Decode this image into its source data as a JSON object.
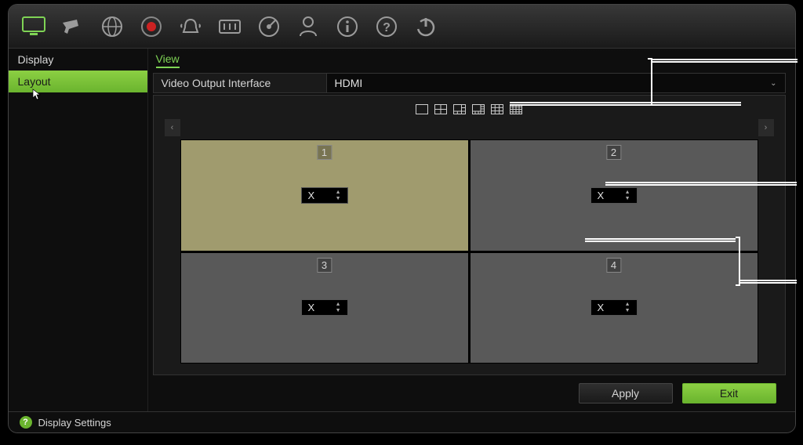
{
  "toolbar_icons": [
    {
      "name": "monitor-icon",
      "active": true
    },
    {
      "name": "camera-icon"
    },
    {
      "name": "globe-icon"
    },
    {
      "name": "record-icon"
    },
    {
      "name": "alarm-icon"
    },
    {
      "name": "settings-slider-icon"
    },
    {
      "name": "hdd-icon"
    },
    {
      "name": "user-icon"
    },
    {
      "name": "info-icon"
    },
    {
      "name": "help-icon"
    },
    {
      "name": "power-icon"
    }
  ],
  "sidebar": {
    "items": [
      {
        "label": "Display",
        "active": false
      },
      {
        "label": "Layout",
        "active": true
      }
    ]
  },
  "tabs": [
    {
      "label": "View",
      "active": true
    }
  ],
  "video_output": {
    "label": "Video Output Interface",
    "value": "HDMI"
  },
  "layout_icons": [
    {
      "name": "layout-1x1-icon"
    },
    {
      "name": "layout-2x2-icon"
    },
    {
      "name": "layout-1plus5-icon"
    },
    {
      "name": "layout-1plus7-icon"
    },
    {
      "name": "layout-3x3-icon"
    },
    {
      "name": "layout-4x4-icon"
    }
  ],
  "cells": [
    {
      "num": "1",
      "value": "X",
      "selected": true
    },
    {
      "num": "2",
      "value": "X",
      "selected": false
    },
    {
      "num": "3",
      "value": "X",
      "selected": false
    },
    {
      "num": "4",
      "value": "X",
      "selected": false
    }
  ],
  "buttons": {
    "apply": "Apply",
    "exit": "Exit"
  },
  "status": {
    "text": "Display Settings"
  }
}
